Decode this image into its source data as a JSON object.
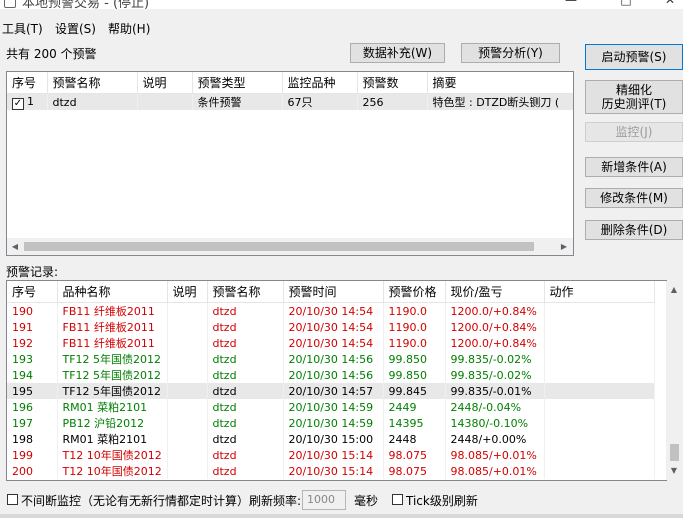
{
  "window": {
    "title": "本地预警交易 - (停止)"
  },
  "menu": [
    {
      "label": "工具(T)"
    },
    {
      "label": "设置(S)"
    },
    {
      "label": "帮助(H)"
    }
  ],
  "alert_count_text": "共有 200 个预警",
  "toolbar": {
    "data_fill": "数据补充(W)",
    "alert_analysis": "预警分析(Y)"
  },
  "side_buttons": {
    "start": "启动预警(S)",
    "refine_line1": "精细化",
    "refine_line2": "历史测评(T)",
    "monitor": "监控(J)",
    "add": "新增条件(A)",
    "modify": "修改条件(M)",
    "delete": "删除条件(D)"
  },
  "alerts_table": {
    "headers": [
      "序号",
      "预警名称",
      "说明",
      "预警类型",
      "监控品种",
      "预警数",
      "摘要"
    ],
    "rows": [
      {
        "checked": true,
        "cells": [
          "1",
          "dtzd",
          "",
          "条件预警",
          "67只",
          "256",
          "特色型 : DTZD断头铡刀 ("
        ]
      }
    ]
  },
  "records_label": "预警记录:",
  "records_table": {
    "headers": [
      "序号",
      "品种名称",
      "说明",
      "预警名称",
      "预警时间",
      "预警价格",
      "现价/盈亏",
      "动作"
    ],
    "rows": [
      {
        "color": "red",
        "cells": [
          "190",
          "FB11 纤维板2011",
          "",
          "dtzd",
          "20/10/30 14:54",
          "1190.0",
          "1200.0/+0.84%",
          ""
        ]
      },
      {
        "color": "red",
        "cells": [
          "191",
          "FB11 纤维板2011",
          "",
          "dtzd",
          "20/10/30 14:54",
          "1190.0",
          "1200.0/+0.84%",
          ""
        ]
      },
      {
        "color": "red",
        "cells": [
          "192",
          "FB11 纤维板2011",
          "",
          "dtzd",
          "20/10/30 14:54",
          "1190.0",
          "1200.0/+0.84%",
          ""
        ]
      },
      {
        "color": "green",
        "cells": [
          "193",
          "TF12 5年国债2012",
          "",
          "dtzd",
          "20/10/30 14:56",
          "99.850",
          "99.835/-0.02%",
          ""
        ]
      },
      {
        "color": "green",
        "cells": [
          "194",
          "TF12 5年国债2012",
          "",
          "dtzd",
          "20/10/30 14:56",
          "99.850",
          "99.835/-0.02%",
          ""
        ]
      },
      {
        "color": "black",
        "selected": true,
        "cells": [
          "195",
          "TF12 5年国债2012",
          "",
          "dtzd",
          "20/10/30 14:57",
          "99.845",
          "99.835/-0.01%",
          ""
        ]
      },
      {
        "color": "green",
        "cells": [
          "196",
          "RM01 菜粕2101",
          "",
          "dtzd",
          "20/10/30 14:59",
          "2449",
          "2448/-0.04%",
          ""
        ]
      },
      {
        "color": "green",
        "cells": [
          "197",
          "PB12 沪铅2012",
          "",
          "dtzd",
          "20/10/30 14:59",
          "14395",
          "14380/-0.10%",
          ""
        ]
      },
      {
        "color": "black",
        "cells": [
          "198",
          "RM01 菜粕2101",
          "",
          "dtzd",
          "20/10/30 15:00",
          "2448",
          "2448/+0.00%",
          ""
        ]
      },
      {
        "color": "red",
        "cells": [
          "199",
          "T12 10年国债2012",
          "",
          "dtzd",
          "20/10/30 15:14",
          "98.075",
          "98.085/+0.01%",
          ""
        ]
      },
      {
        "color": "red",
        "cells": [
          "200",
          "T12 10年国债2012",
          "",
          "dtzd",
          "20/10/30 15:14",
          "98.075",
          "98.085/+0.01%",
          ""
        ]
      }
    ]
  },
  "bottom": {
    "nonstop_label": "不间断监控（无论有无新行情都定时计算）刷新频率:",
    "refresh_value": "1000",
    "ms_label": "毫秒",
    "tick_label": "Tick级别刷新"
  },
  "colors": {
    "red": "#d40000",
    "green": "#008000",
    "accent": "#0078d7"
  }
}
